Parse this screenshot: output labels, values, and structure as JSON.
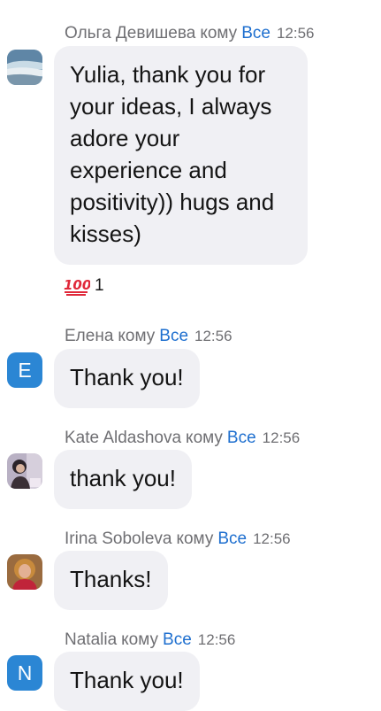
{
  "recipient_word": "кому",
  "messages": [
    {
      "sender": "Ольга Девишева",
      "to": "Все",
      "time": "12:56",
      "avatar": "landscape-photo",
      "text": "Yulia, thank you for your ideas, I always adore your experience and positivity)) hugs and kisses)",
      "reaction": {
        "emoji": "hundred-points-icon",
        "count": "1"
      }
    },
    {
      "sender": "Елена",
      "to": "Все",
      "time": "12:56",
      "avatar_letter": "E",
      "text": "Thank you!"
    },
    {
      "sender": "Kate Aldashova",
      "to": "Все",
      "time": "12:56",
      "avatar": "portrait-photo",
      "text": "thank you!"
    },
    {
      "sender": "Irina Soboleva",
      "to": "Все",
      "time": "12:56",
      "avatar": "portrait-photo",
      "text": "Thanks!"
    },
    {
      "sender": "Natalia",
      "to": "Все",
      "time": "12:56",
      "avatar_letter": "N",
      "text": "Thank you!"
    }
  ],
  "colors": {
    "link_blue": "#1e6fcf",
    "bubble_bg": "#f0f0f4",
    "letter_avatar_bg": "#2b86d4",
    "meta_gray": "#6f6f73"
  }
}
